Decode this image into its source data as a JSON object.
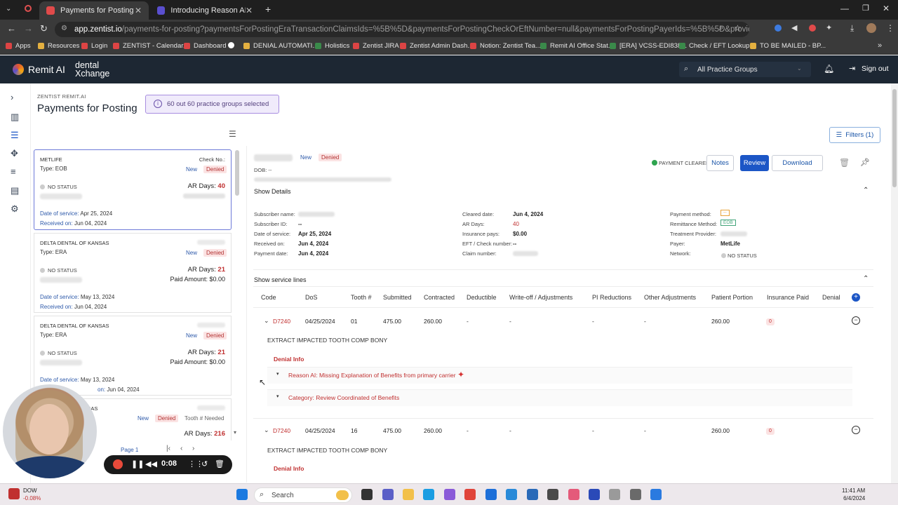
{
  "browser": {
    "tabs": [
      {
        "title": "Payments for Posting",
        "active": true
      },
      {
        "title": "Introducing Reason AI for Enha",
        "active": false
      }
    ],
    "url_host": "app.zentist.io",
    "url_path": "/payments-for-posting?paymentsForPostingEraTransactionClaimsIds=%5B%5D&paymentsForPostingCheckOrEftNumber=null&paymentsForPostingPayerIds=%5B%5D&providedPracticeID=78621&providedP...",
    "bookmarks": [
      "Apps",
      "Resources",
      "Login",
      "ZENTIST - Calendar...",
      "Dashboard",
      "DENIAL AUTOMATI...",
      "Holistics",
      "Zentist JIRA",
      "Zentist Admin Dash...",
      "Notion: Zentist Tea...",
      "Remit AI Office Stat...",
      "[ERA] VCSS-EDI838...",
      "Check / EFT Lookup...",
      "TO BE MAILED - BP..."
    ]
  },
  "header": {
    "brand": "Remit AI",
    "partner_line1": "dental",
    "partner_line2": "Xchange",
    "practice_group": "All Practice Groups",
    "signout": "Sign out"
  },
  "page": {
    "crumb": "ZENTIST REMIT.AI",
    "title": "Payments for Posting",
    "selection_chip": "60 out 60 practice groups selected",
    "filters": "Filters (1)"
  },
  "list": {
    "cards": [
      {
        "payer": "METLIFE",
        "check_label": "Check No.:",
        "type": "Type: EOB",
        "badge_new": "New",
        "badge_denied": "Denied",
        "status": "NO STATUS",
        "ar_label": "AR Days:",
        "ar_days": "40",
        "dos_label": "Date of service:",
        "dos": "Apr 25, 2024",
        "rcv_label": "Received on:",
        "rcv": "Jun 04, 2024"
      },
      {
        "payer": "DELTA DENTAL OF KANSAS",
        "type": "Type: ERA",
        "badge_new": "New",
        "badge_denied": "Denied",
        "status": "NO STATUS",
        "ar_label": "AR Days:",
        "ar_days": "21",
        "paid": "Paid Amount: $0.00",
        "dos_label": "Date of service:",
        "dos": "May 13, 2024",
        "rcv_label": "Received on:",
        "rcv": "Jun 04, 2024"
      },
      {
        "payer": "DELTA DENTAL OF KANSAS",
        "type": "Type: ERA",
        "badge_new": "New",
        "badge_denied": "Denied",
        "status": "NO STATUS",
        "ar_label": "AR Days:",
        "ar_days": "21",
        "paid": "Paid Amount: $0.00",
        "dos_label": "Date of service:",
        "dos": "May 13, 2024",
        "rcv_label": "on:",
        "rcv": "Jun 04, 2024"
      },
      {
        "payer": "NSAS",
        "badge_new": "New",
        "badge_denied": "Denied",
        "badge_tooth": "Tooth # Needed",
        "ar_label": "AR Days:",
        "ar_days": "216"
      }
    ],
    "page_label": "Page 1"
  },
  "recorder": {
    "time": "0:08"
  },
  "detail": {
    "badge_new": "New",
    "badge_denied": "Denied",
    "dob": "DOB: --",
    "payment_status": "PAYMENT CLEARED",
    "notes": "Notes",
    "review": "Review",
    "download": "Download",
    "show_details": "Show Details",
    "col1": [
      {
        "label": "Subscriber name:",
        "value": ""
      },
      {
        "label": "Subscriber ID:",
        "value": "--"
      },
      {
        "label": "Date of service:",
        "value": "Apr 25, 2024"
      },
      {
        "label": "Received on:",
        "value": "Jun 4, 2024"
      },
      {
        "label": "Payment date:",
        "value": "Jun 4, 2024"
      }
    ],
    "col2": [
      {
        "label": "Cleared date:",
        "value": "Jun 4, 2024"
      },
      {
        "label": "AR Days:",
        "value": "40"
      },
      {
        "label": "Insurance pays:",
        "value": "$0.00"
      },
      {
        "label": "EFT / Check number:",
        "value": "--"
      },
      {
        "label": "Claim number:",
        "value": ""
      }
    ],
    "col3": [
      {
        "label": "Payment method:",
        "value": "--"
      },
      {
        "label": "Remittance Method:",
        "value": "EOB"
      },
      {
        "label": "Treatment Provider:",
        "value": ""
      },
      {
        "label": "Payer:",
        "value": "MetLife"
      },
      {
        "label": "Network:",
        "value": "NO STATUS"
      }
    ],
    "show_service_lines": "Show service lines",
    "table_headers": [
      "Code",
      "DoS",
      "Tooth #",
      "Submitted",
      "Contracted",
      "Deductible",
      "Write-off / Adjustments",
      "PI Reductions",
      "Other Adjustments",
      "Patient Portion",
      "Insurance Paid",
      "Denial"
    ],
    "lines": [
      {
        "code": "D7240",
        "dos": "04/25/2024",
        "tooth": "01",
        "submitted": "475.00",
        "contracted": "260.00",
        "deductible": "-",
        "writeoff": "-",
        "pi": "-",
        "other": "-",
        "patient": "260.00",
        "ins_paid": "0",
        "desc": "EXTRACT IMPACTED TOOTH COMP BONY",
        "denial_title": "Denial Info",
        "reason": "Reason AI: Missing Explanation of Benefits from primary carrier",
        "category": "Category: Review Coordinated of Benefits"
      },
      {
        "code": "D7240",
        "dos": "04/25/2024",
        "tooth": "16",
        "submitted": "475.00",
        "contracted": "260.00",
        "deductible": "-",
        "writeoff": "-",
        "pi": "-",
        "other": "-",
        "patient": "260.00",
        "ins_paid": "0",
        "desc": "EXTRACT IMPACTED TOOTH COMP BONY",
        "denial_title": "Denial Info"
      }
    ]
  },
  "taskbar": {
    "stock_name": "DOW",
    "stock_change": "-0.08%",
    "search": "Search",
    "time": "11:41 AM",
    "date": "6/4/2024"
  },
  "colors": {
    "accent": "#1c56c6",
    "denied": "#c03030",
    "header_bg": "#1d2733"
  }
}
